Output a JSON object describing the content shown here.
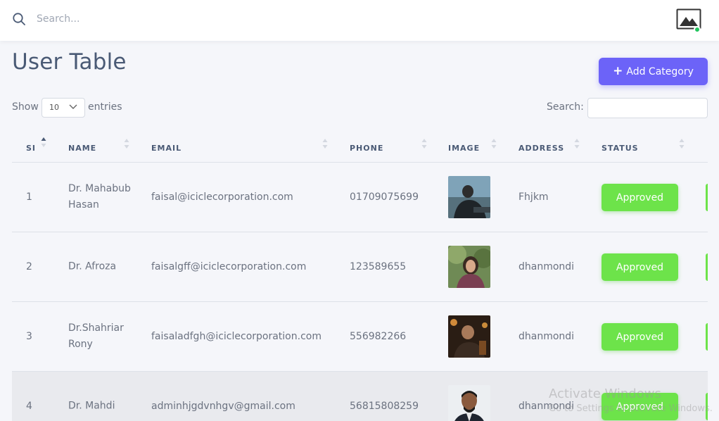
{
  "topbar": {
    "search_placeholder": "Search...",
    "icons": {
      "search": "search-icon",
      "avatar": "image-placeholder-icon"
    },
    "online_color": "#22c55e"
  },
  "page": {
    "title": "User Table",
    "add_button_icon": "+",
    "add_button_label": "Add Category",
    "accent": "#6c63f8"
  },
  "controls": {
    "show_label": "Show",
    "entries_value": "10",
    "entries_label": "entries",
    "search_label": "Search:"
  },
  "table": {
    "columns": [
      "SI",
      "NAME",
      "EMAIL",
      "PHONE",
      "IMAGE",
      "ADDRESS",
      "STATUS"
    ],
    "rows": [
      {
        "si": "1",
        "name": "Dr. Mahabub Hasan",
        "email": "faisal@iciclecorporation.com",
        "phone": "01709075699",
        "image": "user-photo",
        "address": "Fhjkm",
        "status": "Approved"
      },
      {
        "si": "2",
        "name": "Dr. Afroza",
        "email": "faisalgff@iciclecorporation.com",
        "phone": "123589655",
        "image": "user-photo",
        "address": "dhanmondi",
        "status": "Approved"
      },
      {
        "si": "3",
        "name": "Dr.Shahriar Rony",
        "email": "faisaladfgh@iciclecorporation.com",
        "phone": "556982266",
        "image": "user-photo",
        "address": "dhanmondi",
        "status": "Approved"
      },
      {
        "si": "4",
        "name": "Dr. Mahdi",
        "email": "adminhjgdvnhgv@gmail.com",
        "phone": "56815808259",
        "image": "user-photo",
        "address": "dhanmondi",
        "status": "Approved"
      }
    ],
    "status_color": "#6de34a"
  },
  "watermark": {
    "line1": "Activate Windows",
    "line2": "Go to Settings to activate Windows."
  }
}
